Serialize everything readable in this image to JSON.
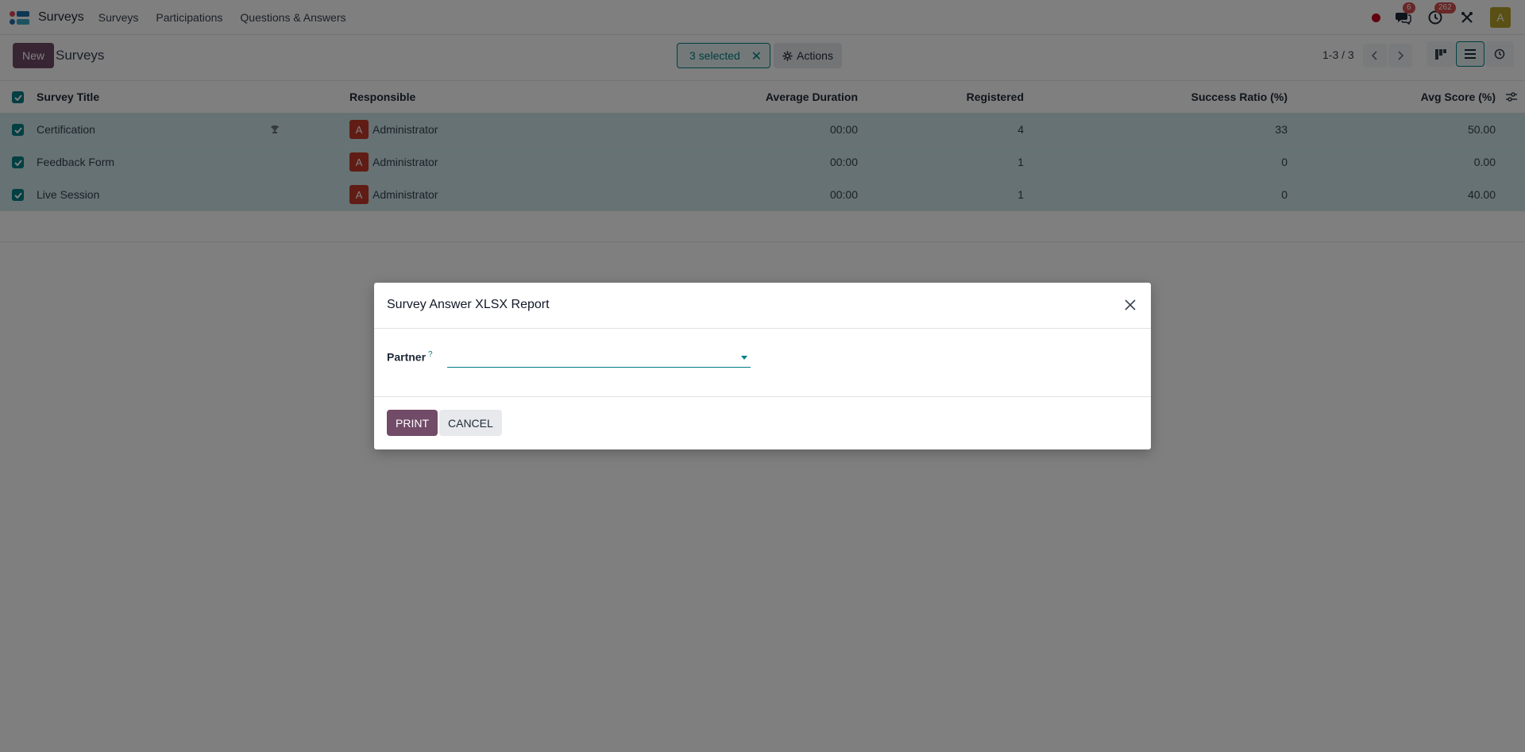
{
  "navbar": {
    "brand": "Surveys",
    "menu": [
      "Surveys",
      "Participations",
      "Questions & Answers"
    ],
    "messages_count": "6",
    "activities_count": "262",
    "user_initial": "A"
  },
  "control_panel": {
    "new_label": "New",
    "title": "Surveys",
    "selected_label": "3 selected",
    "actions_label": "Actions",
    "pager": "1-3 / 3"
  },
  "table": {
    "columns": {
      "title": "Survey Title",
      "responsible": "Responsible",
      "duration": "Average Duration",
      "registered": "Registered",
      "success": "Success Ratio (%)",
      "avg": "Avg Score (%)"
    },
    "rows": [
      {
        "title": "Certification",
        "responsible_initial": "A",
        "responsible": "Administrator",
        "duration": "00:00",
        "registered": "4",
        "success": "33",
        "avg": "50.00"
      },
      {
        "title": "Feedback Form",
        "responsible_initial": "A",
        "responsible": "Administrator",
        "duration": "00:00",
        "registered": "1",
        "success": "0",
        "avg": "0.00"
      },
      {
        "title": "Live Session",
        "responsible_initial": "A",
        "responsible": "Administrator",
        "duration": "00:00",
        "registered": "1",
        "success": "0",
        "avg": "40.00"
      }
    ]
  },
  "modal": {
    "title": "Survey Answer XLSX Report",
    "partner_label": "Partner",
    "partner_help": "?",
    "partner_value": "",
    "print_label": "PRINT",
    "cancel_label": "CANCEL"
  },
  "colors": {
    "primary": "#714b67",
    "accent": "#017e84",
    "selected_row": "#cde4e6"
  }
}
